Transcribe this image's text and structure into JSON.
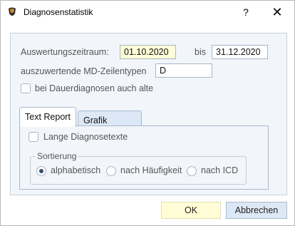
{
  "window": {
    "title": "Diagnosenstatistik",
    "help_glyph": "?",
    "close_glyph": "✕"
  },
  "period": {
    "label": "Auswertungszeitraum:",
    "from_value": "01.10.2020",
    "to_label": "bis",
    "to_value": "31.12.2020"
  },
  "md_types": {
    "label": "auszuwertende MD-Zeilentypen",
    "value": "D"
  },
  "old_diagnoses": {
    "label": "bei Dauerdiagnosen auch alte",
    "checked": false
  },
  "tabs": [
    {
      "label": "Text Report",
      "active": true
    },
    {
      "label": "Grafik Report",
      "active": false
    }
  ],
  "text_report": {
    "long_texts_label": "Lange Diagnosetexte",
    "long_texts_checked": false,
    "sort_group_label": "Sortierung",
    "sort_options": [
      {
        "label": "alphabetisch",
        "selected": true
      },
      {
        "label": "nach Häufigkeit",
        "selected": false
      },
      {
        "label": "nach ICD",
        "selected": false
      }
    ]
  },
  "buttons": {
    "ok": "OK",
    "cancel": "Abbrechen"
  },
  "colors": {
    "panel_bg": "#f2f6fb",
    "highlight_bg": "#fffcd6",
    "tab_inactive_bg": "#dce8f6",
    "radio_dot": "#2f4e75"
  }
}
